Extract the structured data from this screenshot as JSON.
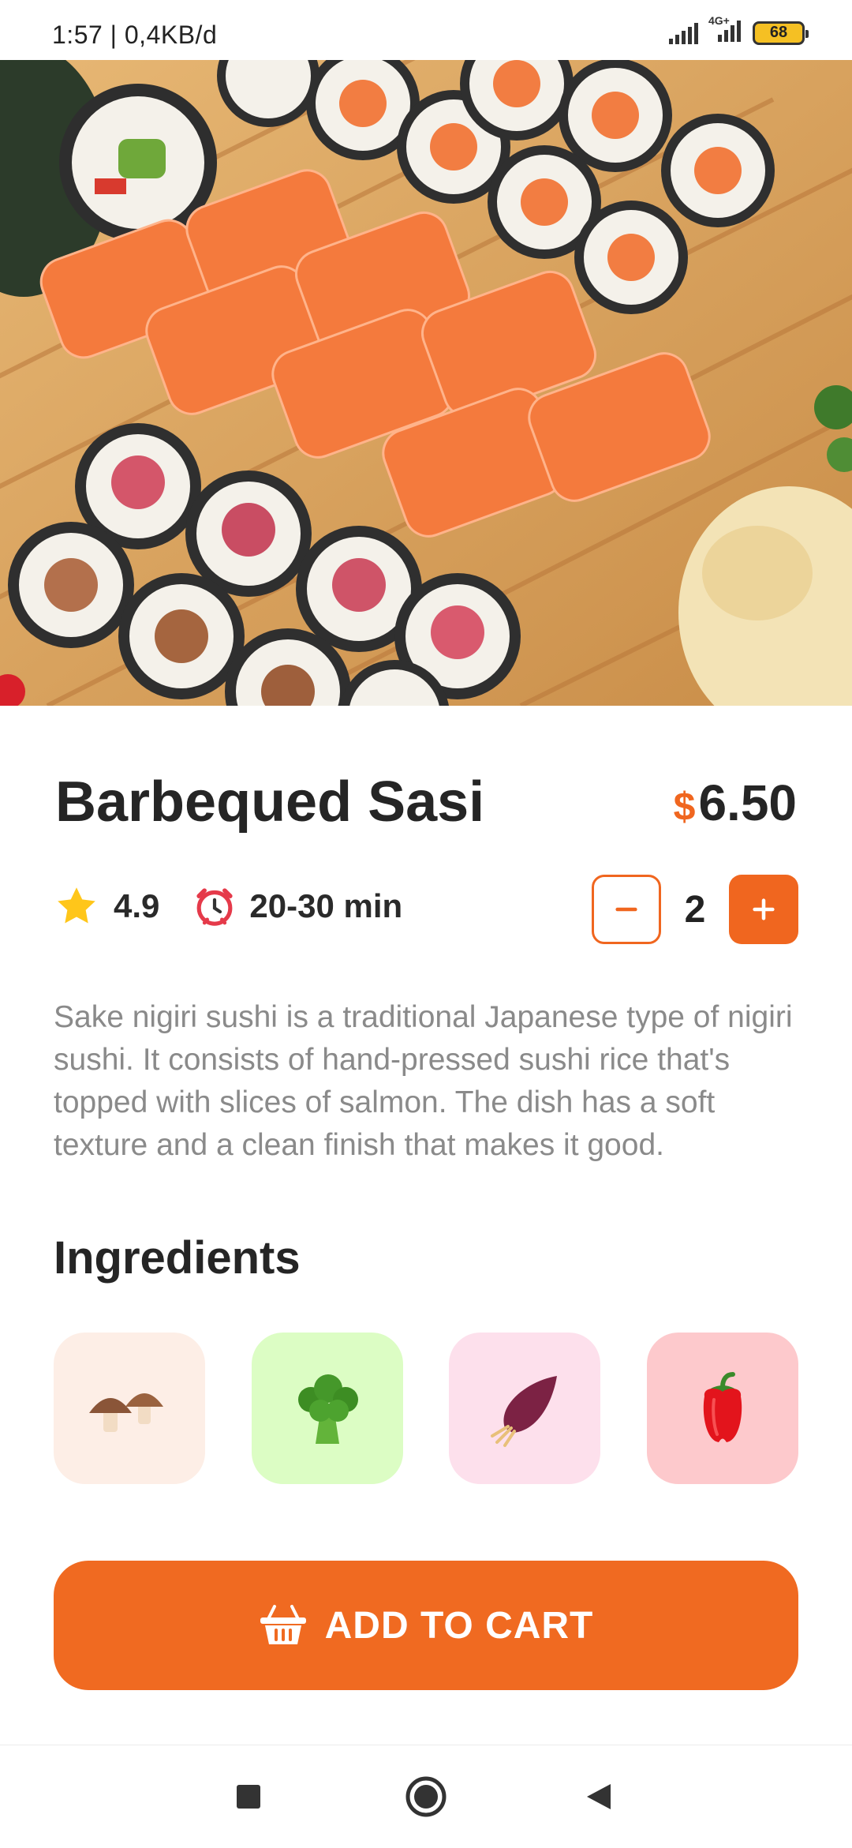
{
  "status_bar": {
    "time_text": "1:57 | 0,4KB/d",
    "network_label": "4G+",
    "battery_level": "68"
  },
  "hero": {
    "image_alt": "Sushi rolls on wooden board"
  },
  "product": {
    "name": "Barbequed Sasi",
    "currency_symbol": "$",
    "price": "6.50",
    "rating": "4.9",
    "delivery_time": "20-30 min",
    "quantity": "2",
    "description": "Sake nigiri sushi is a traditional Japanese type of nigiri sushi. It consists of hand-pressed sushi rice that's topped with slices of salmon. The dish has a soft texture and a clean finish that makes it good."
  },
  "ingredients": {
    "title": "Ingredients",
    "items": [
      {
        "icon": "mushroom-icon",
        "bg": "#fdeee6"
      },
      {
        "icon": "broccoli-icon",
        "bg": "#dcfdc4"
      },
      {
        "icon": "onion-icon",
        "bg": "#fde0ec"
      },
      {
        "icon": "pepper-icon",
        "bg": "#fdc9cc"
      }
    ]
  },
  "cta": {
    "label": "ADD TO CART"
  },
  "colors": {
    "accent": "#f0661f",
    "text_primary": "#252525",
    "text_secondary": "#8a8a8a"
  }
}
